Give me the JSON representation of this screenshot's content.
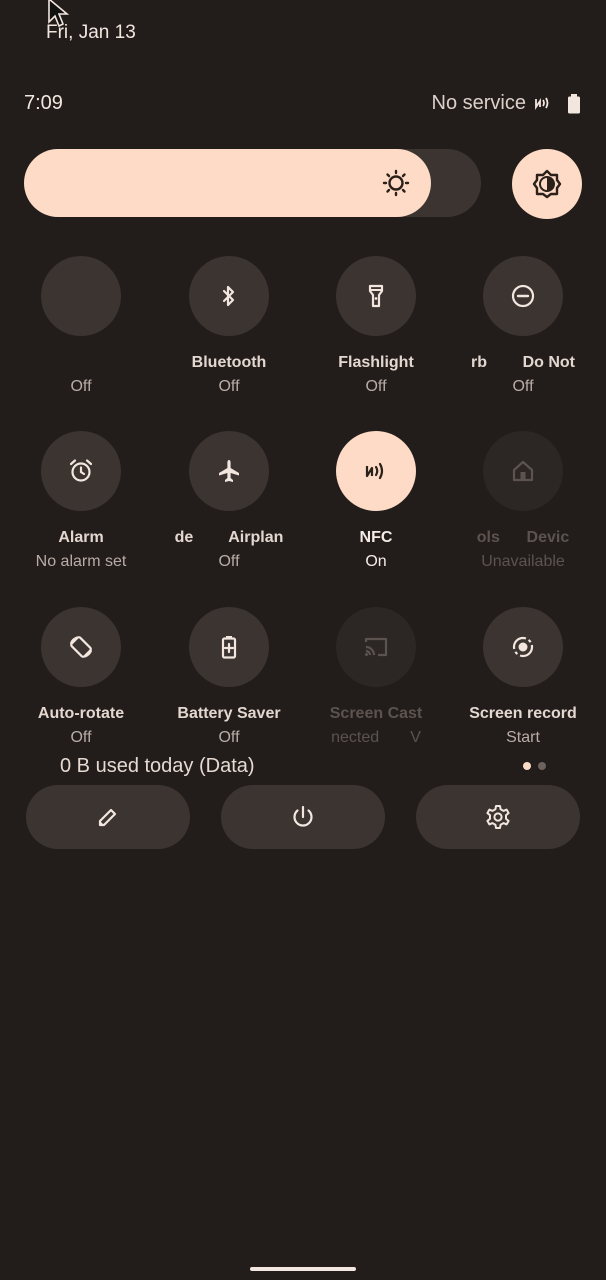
{
  "status_bar": {
    "date": "Fri, Jan 13",
    "time": "7:09",
    "service": "No service",
    "icons": [
      "nfc-icon",
      "battery-icon"
    ]
  },
  "brightness": {
    "level": 0.89,
    "icon": "sun-icon"
  },
  "auto_brightness": {
    "icon": "auto-brightness-icon"
  },
  "colors": {
    "background": "#221d1b",
    "tile_off": "#3b3431",
    "tile_on": "#fddbc6",
    "icon_on": "#2b201a",
    "icon_off": "#f3e6df"
  },
  "tiles": [
    {
      "id": "internet",
      "label": "",
      "state": "Off",
      "status": "off",
      "icon": ""
    },
    {
      "id": "bluetooth",
      "label": "Bluetooth",
      "state": "Off",
      "status": "off",
      "icon": "bluetooth-icon"
    },
    {
      "id": "flashlight",
      "label": "Flashlight",
      "state": "Off",
      "status": "off",
      "icon": "flashlight-icon"
    },
    {
      "id": "dnd",
      "label": "rb        Do Not",
      "state": "Off",
      "status": "off",
      "icon": "do-not-disturb-icon"
    },
    {
      "id": "alarm",
      "label": "Alarm",
      "state": "No alarm set",
      "status": "off",
      "icon": "alarm-icon"
    },
    {
      "id": "airplane",
      "label": "de        Airplan",
      "state": "Off",
      "status": "off",
      "icon": "airplane-icon"
    },
    {
      "id": "nfc",
      "label": "NFC",
      "state": "On",
      "status": "on",
      "icon": "nfc-icon"
    },
    {
      "id": "device-controls",
      "label": "ols      Devic",
      "state": "Unavailable",
      "status": "unavailable",
      "icon": "home-icon"
    },
    {
      "id": "auto-rotate",
      "label": "Auto-rotate",
      "state": "Off",
      "status": "off",
      "icon": "auto-rotate-icon"
    },
    {
      "id": "battery-saver",
      "label": "Battery Saver",
      "state": "Off",
      "status": "off",
      "icon": "battery-saver-icon"
    },
    {
      "id": "screen-cast",
      "label": "Screen Cast",
      "state": "nected       V",
      "status": "unavailable",
      "icon": "cast-icon"
    },
    {
      "id": "screen-record",
      "label": "Screen record",
      "state": "Start",
      "status": "off",
      "icon": "screen-record-icon"
    }
  ],
  "footer": {
    "data_usage": "0 B used today (Data)",
    "page_count": 2,
    "current_page": 1,
    "buttons": [
      {
        "name": "edit-button",
        "icon": "pencil-icon"
      },
      {
        "name": "power-button",
        "icon": "power-icon"
      },
      {
        "name": "settings-button",
        "icon": "gear-icon"
      }
    ]
  }
}
